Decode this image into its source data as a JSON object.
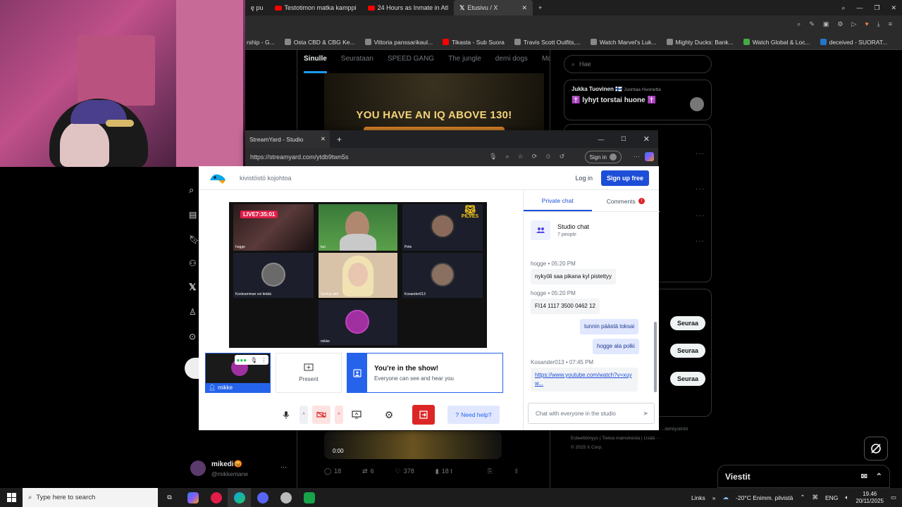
{
  "browser_tabs": [
    {
      "label": "ę pu",
      "icon": "none"
    },
    {
      "label": "Testotimon matka kamppi",
      "icon": "youtube-icon"
    },
    {
      "label": "24 Hours as Inmate in Atl",
      "icon": "youtube-icon"
    },
    {
      "label": "Etusivu / X",
      "icon": "x-icon",
      "active": true
    }
  ],
  "bookmarks": [
    "rship - G...",
    "Osta CBD & CBG Ke...",
    "Vittoria panssarikaul...",
    "Tikasta - Sub Suora",
    "Travis Scott Outfits,...",
    "Watch Marvel's Luk...",
    "Mighty Ducks: Bank...",
    "Watch Global & Loc...",
    "deceived - SUORAT..."
  ],
  "x_feed": {
    "tabs": [
      "Sinulle",
      "Seurataan",
      "SPEED GANG",
      "The jungle",
      "demi dogs",
      "McDonal"
    ],
    "ad_text": "YOU HAVE AN IQ ABOVE 130!",
    "video_time": "0:00",
    "actions": {
      "replies": "18",
      "reposts": "6",
      "likes": "378",
      "views": "18 t"
    }
  },
  "x_sidebar": {
    "search_placeholder": "Hae",
    "space": {
      "host": "Jukka Tuovinen 🇫🇮",
      "status": "Juontaa Huonetta",
      "title": "✝️ lyhyt torstai huone ✝️"
    },
    "follow_label": "Seuraa",
    "footer_line1": "Esteettömyys | Tietoa mainoksista | Lisää ···",
    "footer_line2": "© 2025 X Corp.",
    "footer_top": "...itehöystintö"
  },
  "x_user": {
    "name": "mikedi😡",
    "handle": "@mikkemane"
  },
  "messages_label": "Viestit",
  "streamyard": {
    "window_tab": "StreamYard - Studio",
    "url": "https://streamyard.com/ytdb9twn5s",
    "signin": "Sign in",
    "studio_name": "kivistöstö kojohtoa",
    "login": "Log in",
    "signup": "Sign up free",
    "live_badge": "LIVE7:35:01",
    "tile_names": [
      "hogge",
      "tuo",
      "Pete",
      "Kosteamman voi tietää",
      "Gerli ja aitil",
      "Kosander013",
      "",
      "mikke",
      ""
    ],
    "pilves": "PILVES",
    "my_name": "mikke",
    "present": "Present",
    "inshow_title": "You're in the show!",
    "inshow_sub": "Everyone can see and hear you",
    "help": "Need help?",
    "chat": {
      "tab_private": "Private chat",
      "tab_comments": "Comments",
      "title": "Studio chat",
      "people": "7 people",
      "messages": [
        {
          "meta": "hogge • 05:20 PM",
          "text": "nykyöli saa pikana kyl pistettyy",
          "mine": false
        },
        {
          "meta": "hogge • 05:20 PM",
          "text": "FI14 1117 3500 0462 12",
          "mine": false
        },
        {
          "text": "tunnin päästä toksai",
          "mine": true
        },
        {
          "text": "hogge ala polki",
          "mine": true
        },
        {
          "meta": "Kosander013 • 07:45 PM",
          "text": "https://www.youtube.com/watch?v=xuyw...",
          "mine": false
        }
      ],
      "input_placeholder": "Chat with everyone in the studio"
    }
  },
  "taskbar": {
    "search_placeholder": "Type here to search",
    "links": "Links",
    "weather": "-20°C  Enimm. pilvistä",
    "lang": "ENG",
    "time": "19.46",
    "date": "20/11/2025"
  }
}
